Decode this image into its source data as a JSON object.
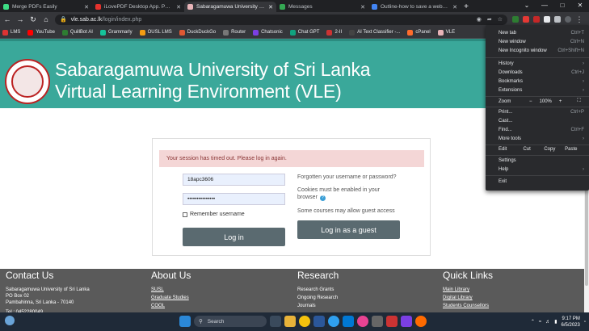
{
  "tabs": [
    {
      "title": "Merge PDFs Easily",
      "color": "#3ddc84",
      "active": false
    },
    {
      "title": "iLovePDF Desktop App. PDF Edit...",
      "color": "#e5322d",
      "active": false
    },
    {
      "title": "Sabaragamuwa University of Sri...",
      "color": "#e8b4b8",
      "active": true
    },
    {
      "title": "Messages",
      "color": "#34a853",
      "active": false
    },
    {
      "title": "Outline-how to save a webpage ...",
      "color": "#4285f4",
      "active": false
    }
  ],
  "address": {
    "host": "vle.sab.ac.lk",
    "path": "/login/index.php"
  },
  "bookmarks": [
    {
      "label": "LMS",
      "color": "#d33"
    },
    {
      "label": "YouTube",
      "color": "#f00"
    },
    {
      "label": "QuillBot AI",
      "color": "#2e7d32"
    },
    {
      "label": "Grammarly",
      "color": "#15c39a"
    },
    {
      "label": "OUSL LMS",
      "color": "#f39c12"
    },
    {
      "label": "DuckDuckGo",
      "color": "#de5833"
    },
    {
      "label": "Router",
      "color": "#777"
    },
    {
      "label": "Chatsonic",
      "color": "#7b3fe4"
    },
    {
      "label": "Chat GPT",
      "color": "#10a37f"
    },
    {
      "label": "2-II",
      "color": "#c33"
    },
    {
      "label": "AI Text Classifier -...",
      "color": "#444"
    },
    {
      "label": "cPanel",
      "color": "#ff6c2c"
    },
    {
      "label": "VLE",
      "color": "#e8b4b8"
    }
  ],
  "site": {
    "title_line1": "Sabaragamuwa University of Sri Lanka",
    "title_line2": "Virtual Learning Environment (VLE)"
  },
  "login": {
    "alert": "Your session has timed out. Please log in again.",
    "username": "18apc3606",
    "password": "•••••••••••••••",
    "remember_label": "Remember username",
    "login_button": "Log in",
    "forgot_text": "Forgotten your username or password?",
    "cookies_text_1": "Cookies must be enabled in your",
    "cookies_text_2": "browser",
    "guest_text": "Some courses may allow guest access",
    "guest_button": "Log in as a guest"
  },
  "footer": {
    "contact": {
      "heading": "Contact Us",
      "lines": [
        "Sabaragamuwa University of Sri Lanka",
        "PO Box 02",
        "Pambahinna, Sri Lanka - 70140",
        "Tel : 0452280049"
      ]
    },
    "about": {
      "heading": "About Us",
      "links": [
        "SUSL",
        "Graduate Studies",
        "COOL"
      ]
    },
    "research": {
      "heading": "Research",
      "links": [
        "Research Grants",
        "Ongoing Research",
        "Journals"
      ]
    },
    "quicklinks": {
      "heading": "Quick Links",
      "links": [
        "Main Library",
        "Digital Library",
        "Students Counsellors"
      ]
    }
  },
  "menu": {
    "new_tab": {
      "label": "New tab",
      "shortcut": "Ctrl+T"
    },
    "new_window": {
      "label": "New window",
      "shortcut": "Ctrl+N"
    },
    "incognito": {
      "label": "New Incognito window",
      "shortcut": "Ctrl+Shift+N"
    },
    "history": {
      "label": "History",
      "shortcut": "›"
    },
    "downloads": {
      "label": "Downloads",
      "shortcut": "Ctrl+J"
    },
    "bookmarks": {
      "label": "Bookmarks",
      "shortcut": "›"
    },
    "extensions": {
      "label": "Extensions",
      "shortcut": "›"
    },
    "zoom_label": "Zoom",
    "zoom_minus": "−",
    "zoom_value": "100%",
    "zoom_plus": "+",
    "print": {
      "label": "Print...",
      "shortcut": "Ctrl+P"
    },
    "cast": {
      "label": "Cast...",
      "shortcut": ""
    },
    "find": {
      "label": "Find...",
      "shortcut": "Ctrl+F"
    },
    "more_tools": {
      "label": "More tools",
      "shortcut": "›"
    },
    "edit": "Edit",
    "cut": "Cut",
    "copy": "Copy",
    "paste": "Paste",
    "settings": {
      "label": "Settings",
      "shortcut": ""
    },
    "help": {
      "label": "Help",
      "shortcut": "›"
    },
    "exit": {
      "label": "Exit",
      "shortcut": ""
    }
  },
  "taskbar": {
    "search_placeholder": "Search",
    "time": "9:17 PM",
    "date": "6/5/2023",
    "apps": [
      "#fff",
      "#1e90ff",
      "#3d7bd8",
      "#e8b33a",
      "#2b579a",
      "#0078d4",
      "#2fa0f0",
      "#1db954",
      "#f0a030",
      "#c33",
      "#ff6a00"
    ]
  },
  "window_controls": {
    "minimize": "—",
    "maximize": "□",
    "close": "✕"
  },
  "misc": {
    "new_tab_plus": "+",
    "tab_list": "⌄",
    "chevron": "›",
    "info_glyph": "?",
    "close_glyph": "✕"
  }
}
